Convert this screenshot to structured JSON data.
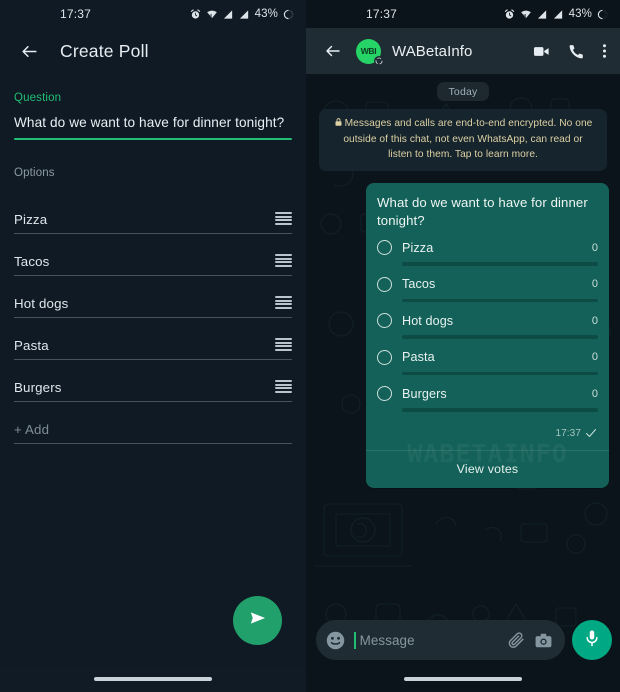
{
  "left_panel": {
    "status_bar": {
      "time": "17:37",
      "battery_percent": "43%",
      "icons": [
        "alarm-icon",
        "wifi-icon",
        "signal-icon",
        "signal-icon",
        "battery-icon"
      ]
    },
    "app_bar": {
      "back_icon": "back-arrow-icon",
      "title": "Create Poll"
    },
    "question_section": {
      "label": "Question",
      "value": "What do we want to have for dinner tonight?"
    },
    "options_section": {
      "label": "Options",
      "items": [
        {
          "text": "Pizza",
          "placeholder": false,
          "handle": "drag-handle-icon"
        },
        {
          "text": "Tacos",
          "placeholder": false,
          "handle": "drag-handle-icon"
        },
        {
          "text": "Hot dogs",
          "placeholder": false,
          "handle": "drag-handle-icon"
        },
        {
          "text": "Pasta",
          "placeholder": false,
          "handle": "drag-handle-icon"
        },
        {
          "text": "Burgers",
          "placeholder": false,
          "handle": "drag-handle-icon"
        },
        {
          "text": "+ Add",
          "placeholder": true,
          "handle": null
        }
      ]
    },
    "send_button": {
      "icon": "send-icon",
      "color": "#22a06b"
    },
    "nav_bar": {
      "pill": "gesture-pill"
    }
  },
  "right_panel": {
    "status_bar": {
      "time": "17:37",
      "battery_percent": "43%"
    },
    "app_bar": {
      "back_icon": "back-arrow-icon",
      "avatar_text": "WBI",
      "contact_name": "WABetaInfo",
      "actions": [
        "video-call-icon",
        "voice-call-icon",
        "overflow-menu-icon"
      ]
    },
    "chat": {
      "day_divider": "Today",
      "encryption_notice": "Messages and calls are end-to-end encrypted. No one outside of this chat, not even WhatsApp, can read or listen to them. Tap to learn more.",
      "poll": {
        "question": "What do we want to have for dinner tonight?",
        "options": [
          {
            "label": "Pizza",
            "count": "0"
          },
          {
            "label": "Tacos",
            "count": "0"
          },
          {
            "label": "Hot dogs",
            "count": "0"
          },
          {
            "label": "Pasta",
            "count": "0"
          },
          {
            "label": "Burgers",
            "count": "0"
          }
        ],
        "timestamp": "17:37",
        "status_icon": "single-check-icon",
        "view_votes_label": "View votes",
        "watermark": "WABETAINFO",
        "bubble_color": "#136158"
      }
    },
    "input_bar": {
      "emoji_icon": "emoji-icon",
      "placeholder": "Message",
      "attach_icon": "paperclip-icon",
      "camera_icon": "camera-icon",
      "mic_icon": "microphone-icon",
      "mic_color": "#00a884"
    },
    "nav_bar": {
      "pill": "gesture-pill"
    }
  }
}
